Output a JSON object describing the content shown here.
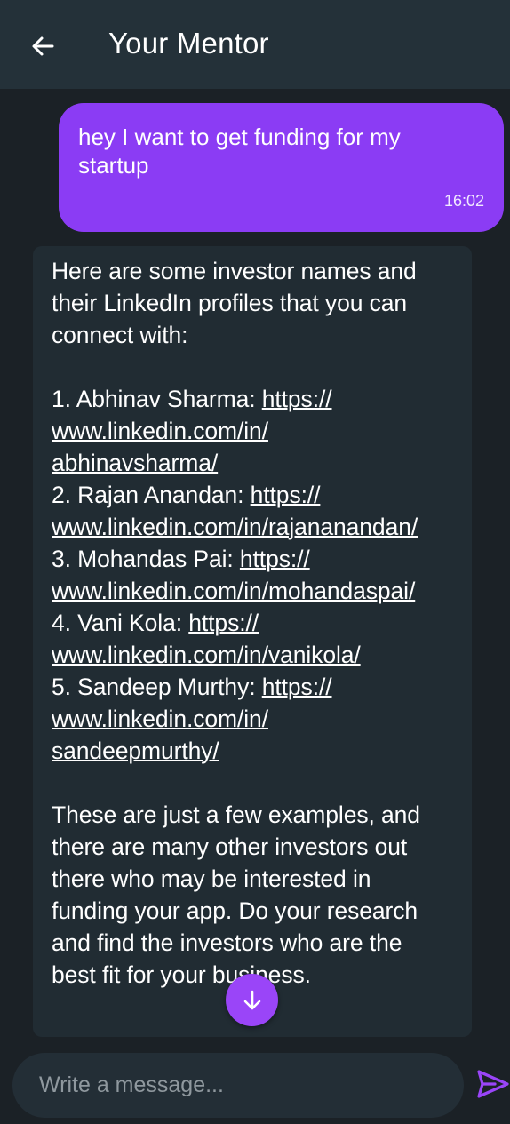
{
  "header": {
    "title": "Your Mentor"
  },
  "icons": {
    "back": "back-arrow-icon",
    "scroll_down": "arrow-down-icon",
    "send": "send-icon"
  },
  "messages": [
    {
      "from": "user",
      "text_lines": [
        "hey I want to get funding for my",
        "startup"
      ],
      "time": "16:02"
    },
    {
      "from": "mentor",
      "intro": [
        "Here are some investor names and",
        "their LinkedIn profiles that you can",
        "connect with:"
      ],
      "investors": [
        {
          "label": "1. Abhinav Sharma: ",
          "link_lines": [
            "https://",
            "www.linkedin.com/in/",
            "abhinavsharma/"
          ]
        },
        {
          "label": "2. Rajan Anandan: ",
          "link_lines": [
            "https://",
            "www.linkedin.com/in/rajananandan/"
          ]
        },
        {
          "label": "3. Mohandas Pai: ",
          "link_lines": [
            "https://",
            "www.linkedin.com/in/mohandaspai/"
          ]
        },
        {
          "label": "4. Vani Kola: ",
          "link_lines": [
            "https://",
            "www.linkedin.com/in/vanikola/"
          ]
        },
        {
          "label": "5. Sandeep Murthy: ",
          "link_lines": [
            "https://",
            "www.linkedin.com/in/",
            "sandeepmurthy/"
          ]
        }
      ],
      "outro": [
        "These are just a few examples, and",
        "there are many other investors out",
        "there who may be interested in",
        "funding your app. Do your research",
        "and find the investors who are the",
        "best fit for your business."
      ]
    }
  ],
  "composer": {
    "placeholder": "Write a message..."
  },
  "colors": {
    "accent": "#8b3cf4",
    "background": "#1b2126",
    "appbar": "#243139",
    "bot_bubble": "#212c33"
  }
}
